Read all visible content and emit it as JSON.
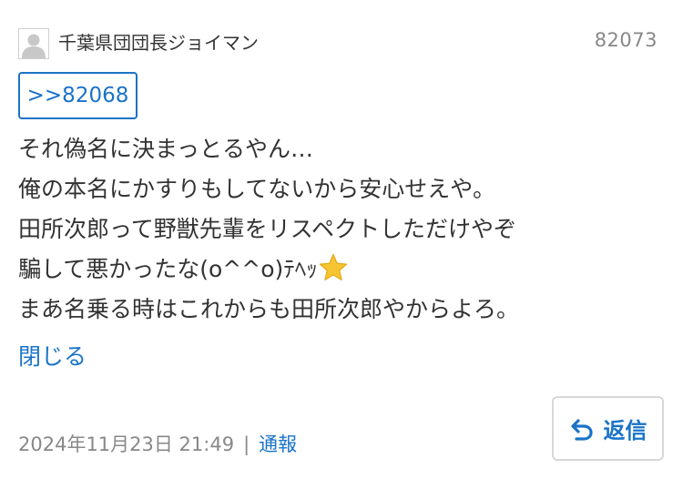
{
  "comment": {
    "username": "千葉県団団長ジョイマン",
    "number": "82073",
    "reply_to": ">>82068",
    "lines": [
      "それ偽名に決まっとるやん…",
      "俺の本名にかすりもしてないから安心せえや。",
      "田所次郎って野獣先輩をリスペクトしただけやぞ",
      "騙して悪かったな(o^^o)ﾃﾍｯ",
      "まあ名乗る時はこれからも田所次郎やからよろ。"
    ],
    "close_label": "閉じる",
    "timestamp": "2024年11月23日 21:49",
    "separator": "|",
    "report_label": "通報",
    "reply_label": "返信"
  },
  "icons": {
    "avatar": "default-avatar-icon",
    "emoji": "star-emoji-icon",
    "reply": "reply-arrow-icon"
  },
  "colors": {
    "link": "#1a73c8",
    "text": "#333333",
    "muted": "#888888",
    "star": "#f7c531"
  }
}
